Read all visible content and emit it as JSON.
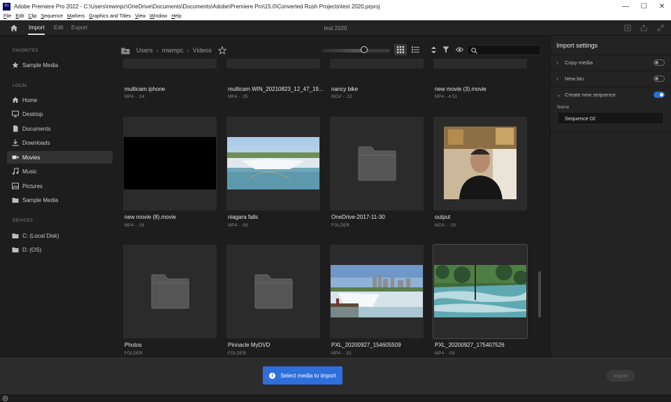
{
  "window": {
    "logo": "Pr",
    "title": "Adobe Premiere Pro 2022 - C:\\Users\\mwmpc\\OneDrive\\Documents\\Documents\\Adobe\\Premiere Pro\\15.0\\Converted Rush Projects\\test 2020.prproj",
    "minimize": "—",
    "maximize": "☐",
    "close": "✕"
  },
  "menu": [
    {
      "accel": "F",
      "rest": "ile"
    },
    {
      "accel": "E",
      "rest": "dit"
    },
    {
      "accel": "C",
      "rest": "lip"
    },
    {
      "accel": "S",
      "rest": "equence"
    },
    {
      "accel": "M",
      "rest": "arkers"
    },
    {
      "accel": "G",
      "rest": "raphics and Titles"
    },
    {
      "accel": "V",
      "rest": "iew"
    },
    {
      "accel": "W",
      "rest": "indow"
    },
    {
      "accel": "H",
      "rest": "elp"
    }
  ],
  "topbar": {
    "tabs": [
      "Import",
      "Edit",
      "Export"
    ],
    "active_tab": "Import",
    "project_title": "test 2020"
  },
  "sidebar": {
    "sections": {
      "favorites": "FAVORITES",
      "local": "LOCAL",
      "devices": "DEVICES"
    },
    "favorites": [
      {
        "label": "Sample Media",
        "icon": "star-icon"
      }
    ],
    "local": [
      {
        "label": "Home",
        "icon": "home-icon"
      },
      {
        "label": "Desktop",
        "icon": "monitor-icon"
      },
      {
        "label": "Documents",
        "icon": "document-icon"
      },
      {
        "label": "Downloads",
        "icon": "download-icon"
      },
      {
        "label": "Movies",
        "icon": "video-camera-icon",
        "selected": true
      },
      {
        "label": "Music",
        "icon": "music-note-icon"
      },
      {
        "label": "Pictures",
        "icon": "picture-icon"
      },
      {
        "label": "Sample Media",
        "icon": "folder-icon"
      }
    ],
    "devices": [
      {
        "label": "C: (Local Disk)",
        "icon": "drive-icon"
      },
      {
        "label": "D: (OS)",
        "icon": "drive-icon"
      }
    ]
  },
  "browser": {
    "breadcrumb": [
      "Users",
      "mwmpc",
      "Videos"
    ],
    "zoom_level": 0.62,
    "view_mode": "grid",
    "items": [
      {
        "name": "multicam iphone",
        "meta": "MP4 - :24",
        "thumb": "partial"
      },
      {
        "name": "multicam WIN_20210823_12_47_19...",
        "meta": "MP4 - :25",
        "thumb": "partial"
      },
      {
        "name": "nancy bike",
        "meta": "MOV - :12",
        "thumb": "partial"
      },
      {
        "name": "new movie (3).movie",
        "meta": "MP4 - 4:51",
        "thumb": "partial"
      },
      {
        "name": "new movie (8).movie",
        "meta": "MP4 - :26",
        "thumb": "black"
      },
      {
        "name": "niagara falls",
        "meta": "MP4 - :09",
        "thumb": "falls"
      },
      {
        "name": "OneDrive-2017-11-30",
        "meta": "FOLDER",
        "thumb": "folder"
      },
      {
        "name": "output",
        "meta": "MOV - :19",
        "thumb": "person"
      },
      {
        "name": "Photos",
        "meta": "FOLDER",
        "thumb": "folder"
      },
      {
        "name": "Pinnacle MyDVD",
        "meta": "FOLDER",
        "thumb": "folder"
      },
      {
        "name": "PXL_20200927_154605509",
        "meta": "MP4 - :33",
        "thumb": "city-falls"
      },
      {
        "name": "PXL_20200927_175407526",
        "meta": "MP4 - :09",
        "thumb": "river"
      }
    ]
  },
  "import_settings": {
    "title": "Import settings",
    "copy_media": {
      "label": "Copy media",
      "on": false
    },
    "new_bin": {
      "label": "New bin",
      "on": false
    },
    "new_sequence": {
      "label": "Create new sequence",
      "on": true
    },
    "name_label": "Name",
    "name_value": "Sequence 02"
  },
  "bottom": {
    "select_label": "Select media to import",
    "import_label": "Import"
  },
  "colors": {
    "accent": "#2f6fdc",
    "panel": "#232323",
    "background": "#1d1d1d"
  }
}
